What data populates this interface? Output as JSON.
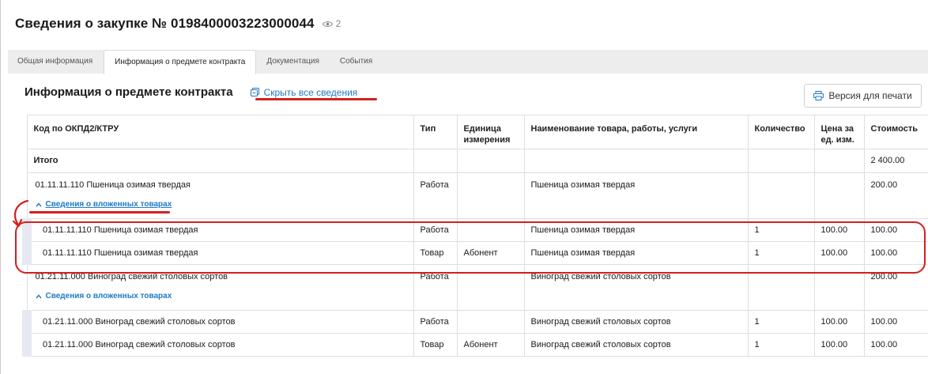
{
  "header": {
    "title": "Сведения о закупке № 0198400003223000044",
    "views_count": "2"
  },
  "tabs": [
    {
      "label": "Общая информация"
    },
    {
      "label": "Информация о предмете контракта"
    },
    {
      "label": "Документация"
    },
    {
      "label": "События"
    }
  ],
  "section": {
    "title": "Информация о предмете контракта",
    "hide_all": "Скрыть все сведения",
    "print_version": "Версия для печати"
  },
  "table": {
    "columns": {
      "code": "Код по ОКПД2/КТРУ",
      "type": "Тип",
      "unit": "Единица измерения",
      "name": "Наименование товара, работы, услуги",
      "qty": "Количество",
      "price": "Цена за ед. изм.",
      "cost": "Стоимость"
    },
    "total": {
      "label": "Итого",
      "cost": "2 400.00"
    },
    "groups": [
      {
        "code": "01.11.11.110 Пшеница озимая твердая",
        "type": "Работа",
        "name": "Пшеница озимая твердая",
        "cost": "200.00",
        "nested_label": "Сведения о вложенных товарах",
        "children": [
          {
            "code": "01.11.11.110 Пшеница озимая твердая",
            "type": "Работа",
            "unit": "",
            "name": "Пшеница озимая твердая",
            "qty": "1",
            "price": "100.00",
            "cost": "100.00"
          },
          {
            "code": "01.11.11.110 Пшеница озимая твердая",
            "type": "Товар",
            "unit": "Абонент",
            "name": "Пшеница озимая твердая",
            "qty": "1",
            "price": "100.00",
            "cost": "100.00"
          }
        ]
      },
      {
        "code": "01.21.11.000 Виноград свежий столовых сортов",
        "type": "Работа",
        "name": "Виноград свежий столовых сортов",
        "cost": "200.00",
        "nested_label": "Сведения о вложенных товарах",
        "children": [
          {
            "code": "01.21.11.000 Виноград свежий столовых сортов",
            "type": "Работа",
            "unit": "",
            "name": "Виноград свежий столовых сортов",
            "qty": "1",
            "price": "100.00",
            "cost": "100.00"
          },
          {
            "code": "01.21.11.000 Виноград свежий столовых сортов",
            "type": "Товар",
            "unit": "Абонент",
            "name": "Виноград свежий столовых сортов",
            "qty": "1",
            "price": "100.00",
            "cost": "100.00"
          }
        ]
      }
    ]
  },
  "colors": {
    "link": "#1f7ac3",
    "annotation_red": "#d41f1f",
    "tab_bar": "#ededed",
    "indent_bar": "#e6e8f2"
  }
}
